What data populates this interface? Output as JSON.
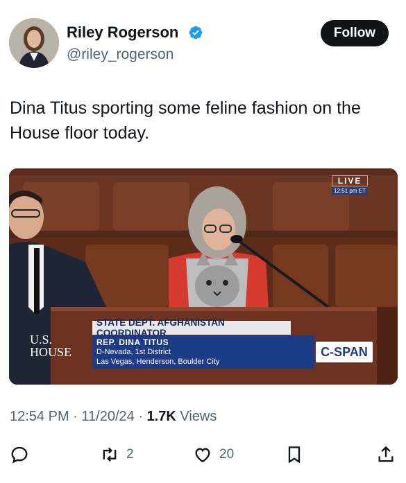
{
  "author": {
    "display_name": "Riley Rogerson",
    "handle": "@riley_rogerson",
    "verified": true,
    "avatar_icon": "profile-photo"
  },
  "follow_button": {
    "label": "Follow"
  },
  "tweet": {
    "text": "Dina Titus sporting some feline fashion on the House floor today."
  },
  "media": {
    "live_label": "LIVE",
    "live_time": "12:51 pm ET",
    "chyron_title": "STATE DEPT. AFGHANISTAN COORDINATOR",
    "chyron_name": "REP. DINA TITUS",
    "chyron_line1": "D-Nevada, 1st District",
    "chyron_line2": "Las Vegas, Henderson, Boulder City",
    "house_logo_line1": "U.S.",
    "house_logo_line2": "HOUSE",
    "network_logo": "C-SPAN"
  },
  "meta": {
    "time": "12:54 PM",
    "date": "11/20/24",
    "views_count": "1.7K",
    "views_label": "Views"
  },
  "actions": {
    "reply_icon": "reply-icon",
    "retweet_count": "2",
    "like_count": "20",
    "bookmark_icon": "bookmark-icon",
    "share_icon": "share-icon"
  },
  "colors": {
    "text_primary": "#0f1419",
    "text_secondary": "#536471",
    "verified_blue": "#1d9bf0",
    "cspan_blue": "#1d3c86"
  }
}
